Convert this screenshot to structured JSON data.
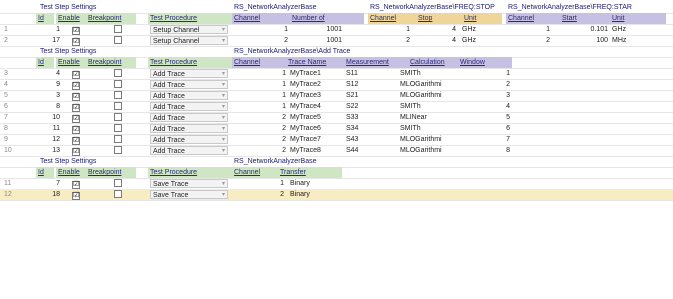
{
  "blocks": [
    {
      "id": "freq",
      "title": "Test Step Settings",
      "headers": [
        "Id",
        "Enable",
        "Breakpoint",
        "Test Procedure"
      ],
      "subheaders": [
        {
          "group": "RS_NetworkAnalyzerBase",
          "cols": [
            "Channel",
            "Number of"
          ]
        },
        {
          "group": "RS_NetworkAnalyzerBase\\FREQ:STOP",
          "cols": [
            "Channel",
            "Stop",
            "Unit"
          ]
        },
        {
          "group": "RS_NetworkAnalyzerBase\\FREQ:STAR",
          "cols": [
            "Channel",
            "Start",
            "Unit"
          ]
        }
      ],
      "rows": [
        {
          "rownum": "1",
          "id": "1",
          "enable": true,
          "breakpoint": false,
          "proc": "Setup Channel",
          "c1": "1",
          "c2": "1001",
          "c3": "1",
          "c4": "4",
          "c5": "GHz",
          "c6": "1",
          "c7": "0.101",
          "c8": "GHz"
        },
        {
          "rownum": "2",
          "id": "17",
          "enable": true,
          "breakpoint": false,
          "proc": "Setup Channel",
          "c1": "2",
          "c2": "1001",
          "c3": "2",
          "c4": "4",
          "c5": "GHz",
          "c6": "2",
          "c7": "100",
          "c8": "MHz"
        }
      ]
    },
    {
      "id": "trace",
      "title": "Test Step Settings",
      "headers": [
        "Id",
        "Enable",
        "Breakpoint",
        "Test Procedure"
      ],
      "group": "RS_NetworkAnalyzerBase\\Add Trace",
      "cols": [
        "Channel",
        "Trace Name",
        "Measurement",
        "Calculation",
        "Window"
      ],
      "rows": [
        {
          "rownum": "3",
          "id": "4",
          "enable": true,
          "breakpoint": false,
          "proc": "Add Trace",
          "ch": "1",
          "name": "MyTrace1",
          "meas": "S11",
          "calc": "SMITh",
          "win": "1"
        },
        {
          "rownum": "4",
          "id": "9",
          "enable": true,
          "breakpoint": false,
          "proc": "Add Trace",
          "ch": "1",
          "name": "MyTrace2",
          "meas": "S12",
          "calc": "MLOGarithmi",
          "win": "2"
        },
        {
          "rownum": "5",
          "id": "3",
          "enable": true,
          "breakpoint": false,
          "proc": "Add Trace",
          "ch": "1",
          "name": "MyTrace3",
          "meas": "S21",
          "calc": "MLOGarithmi",
          "win": "3"
        },
        {
          "rownum": "6",
          "id": "8",
          "enable": true,
          "breakpoint": false,
          "proc": "Add Trace",
          "ch": "1",
          "name": "MyTrace4",
          "meas": "S22",
          "calc": "SMITh",
          "win": "4"
        },
        {
          "rownum": "7",
          "id": "10",
          "enable": true,
          "breakpoint": false,
          "proc": "Add Trace",
          "ch": "2",
          "name": "MyTrace5",
          "meas": "S33",
          "calc": "MLINear",
          "win": "5"
        },
        {
          "rownum": "8",
          "id": "11",
          "enable": true,
          "breakpoint": false,
          "proc": "Add Trace",
          "ch": "2",
          "name": "MyTrace6",
          "meas": "S34",
          "calc": "SMITh",
          "win": "6"
        },
        {
          "rownum": "9",
          "id": "12",
          "enable": true,
          "breakpoint": false,
          "proc": "Add Trace",
          "ch": "2",
          "name": "MyTrace7",
          "meas": "S43",
          "calc": "MLOGarithmi",
          "win": "7"
        },
        {
          "rownum": "10",
          "id": "13",
          "enable": true,
          "breakpoint": false,
          "proc": "Add Trace",
          "ch": "2",
          "name": "MyTrace8",
          "meas": "S44",
          "calc": "MLOGarithmi",
          "win": "8"
        }
      ]
    },
    {
      "id": "save",
      "title": "Test Step Settings",
      "headers": [
        "Id",
        "Enable",
        "Breakpoint",
        "Test Procedure"
      ],
      "group": "RS_NetworkAnalyzerBase",
      "cols": [
        "Channel",
        "Transfer"
      ],
      "rows": [
        {
          "rownum": "11",
          "id": "7",
          "enable": true,
          "breakpoint": false,
          "proc": "Save Trace",
          "ch": "1",
          "transfer": "Binary"
        },
        {
          "rownum": "12",
          "id": "18",
          "enable": true,
          "breakpoint": false,
          "proc": "Save Trace",
          "ch": "2",
          "transfer": "Binary",
          "selected": true
        }
      ]
    }
  ],
  "icons": {
    "checkbox_checked": "☑",
    "dropdown": "▾"
  },
  "colors": {
    "green_header": "#cfe6c4",
    "purple_header": "#c6c0e2",
    "gold_header": "#efd59a",
    "selected_row": "#f8ecc3"
  }
}
